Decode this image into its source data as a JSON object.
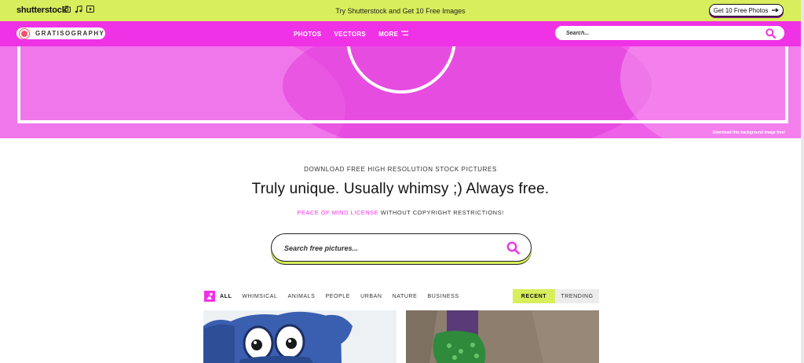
{
  "promo_bar": {
    "logo": "shutterstock",
    "message": "Try Shutterstock and Get 10 Free Images",
    "cta": "Get 10 Free Photos"
  },
  "nav": {
    "brand": "GRATISOGRAPHY",
    "links": [
      "PHOTOS",
      "VECTORS",
      "MORE"
    ],
    "search_placeholder": "Search..."
  },
  "hero": {
    "credit": "Download this background image free!"
  },
  "intro": {
    "kicker": "DOWNLOAD FREE HIGH RESOLUTION STOCK PICTURES",
    "headline": "Truly unique. Usually whimsy ;) Always free.",
    "license_link": "PEACE OF MIND LICENSE",
    "license_rest": "WITHOUT COPYRIGHT RESTRICTIONS!",
    "search_placeholder": "Search free pictures..."
  },
  "filters": {
    "categories": [
      "ALL",
      "WHIMSICAL",
      "ANIMALS",
      "PEOPLE",
      "URBAN",
      "NATURE",
      "BUSINESS"
    ],
    "sort": [
      "RECENT",
      "TRENDING"
    ]
  },
  "colors": {
    "accent_pink": "#f032e6",
    "accent_lime": "#d8ee5c"
  },
  "icons": [
    "camera-icon",
    "music-icon",
    "video-icon",
    "arrow-right-icon",
    "menu-icon",
    "search-icon",
    "all-category-icon"
  ]
}
